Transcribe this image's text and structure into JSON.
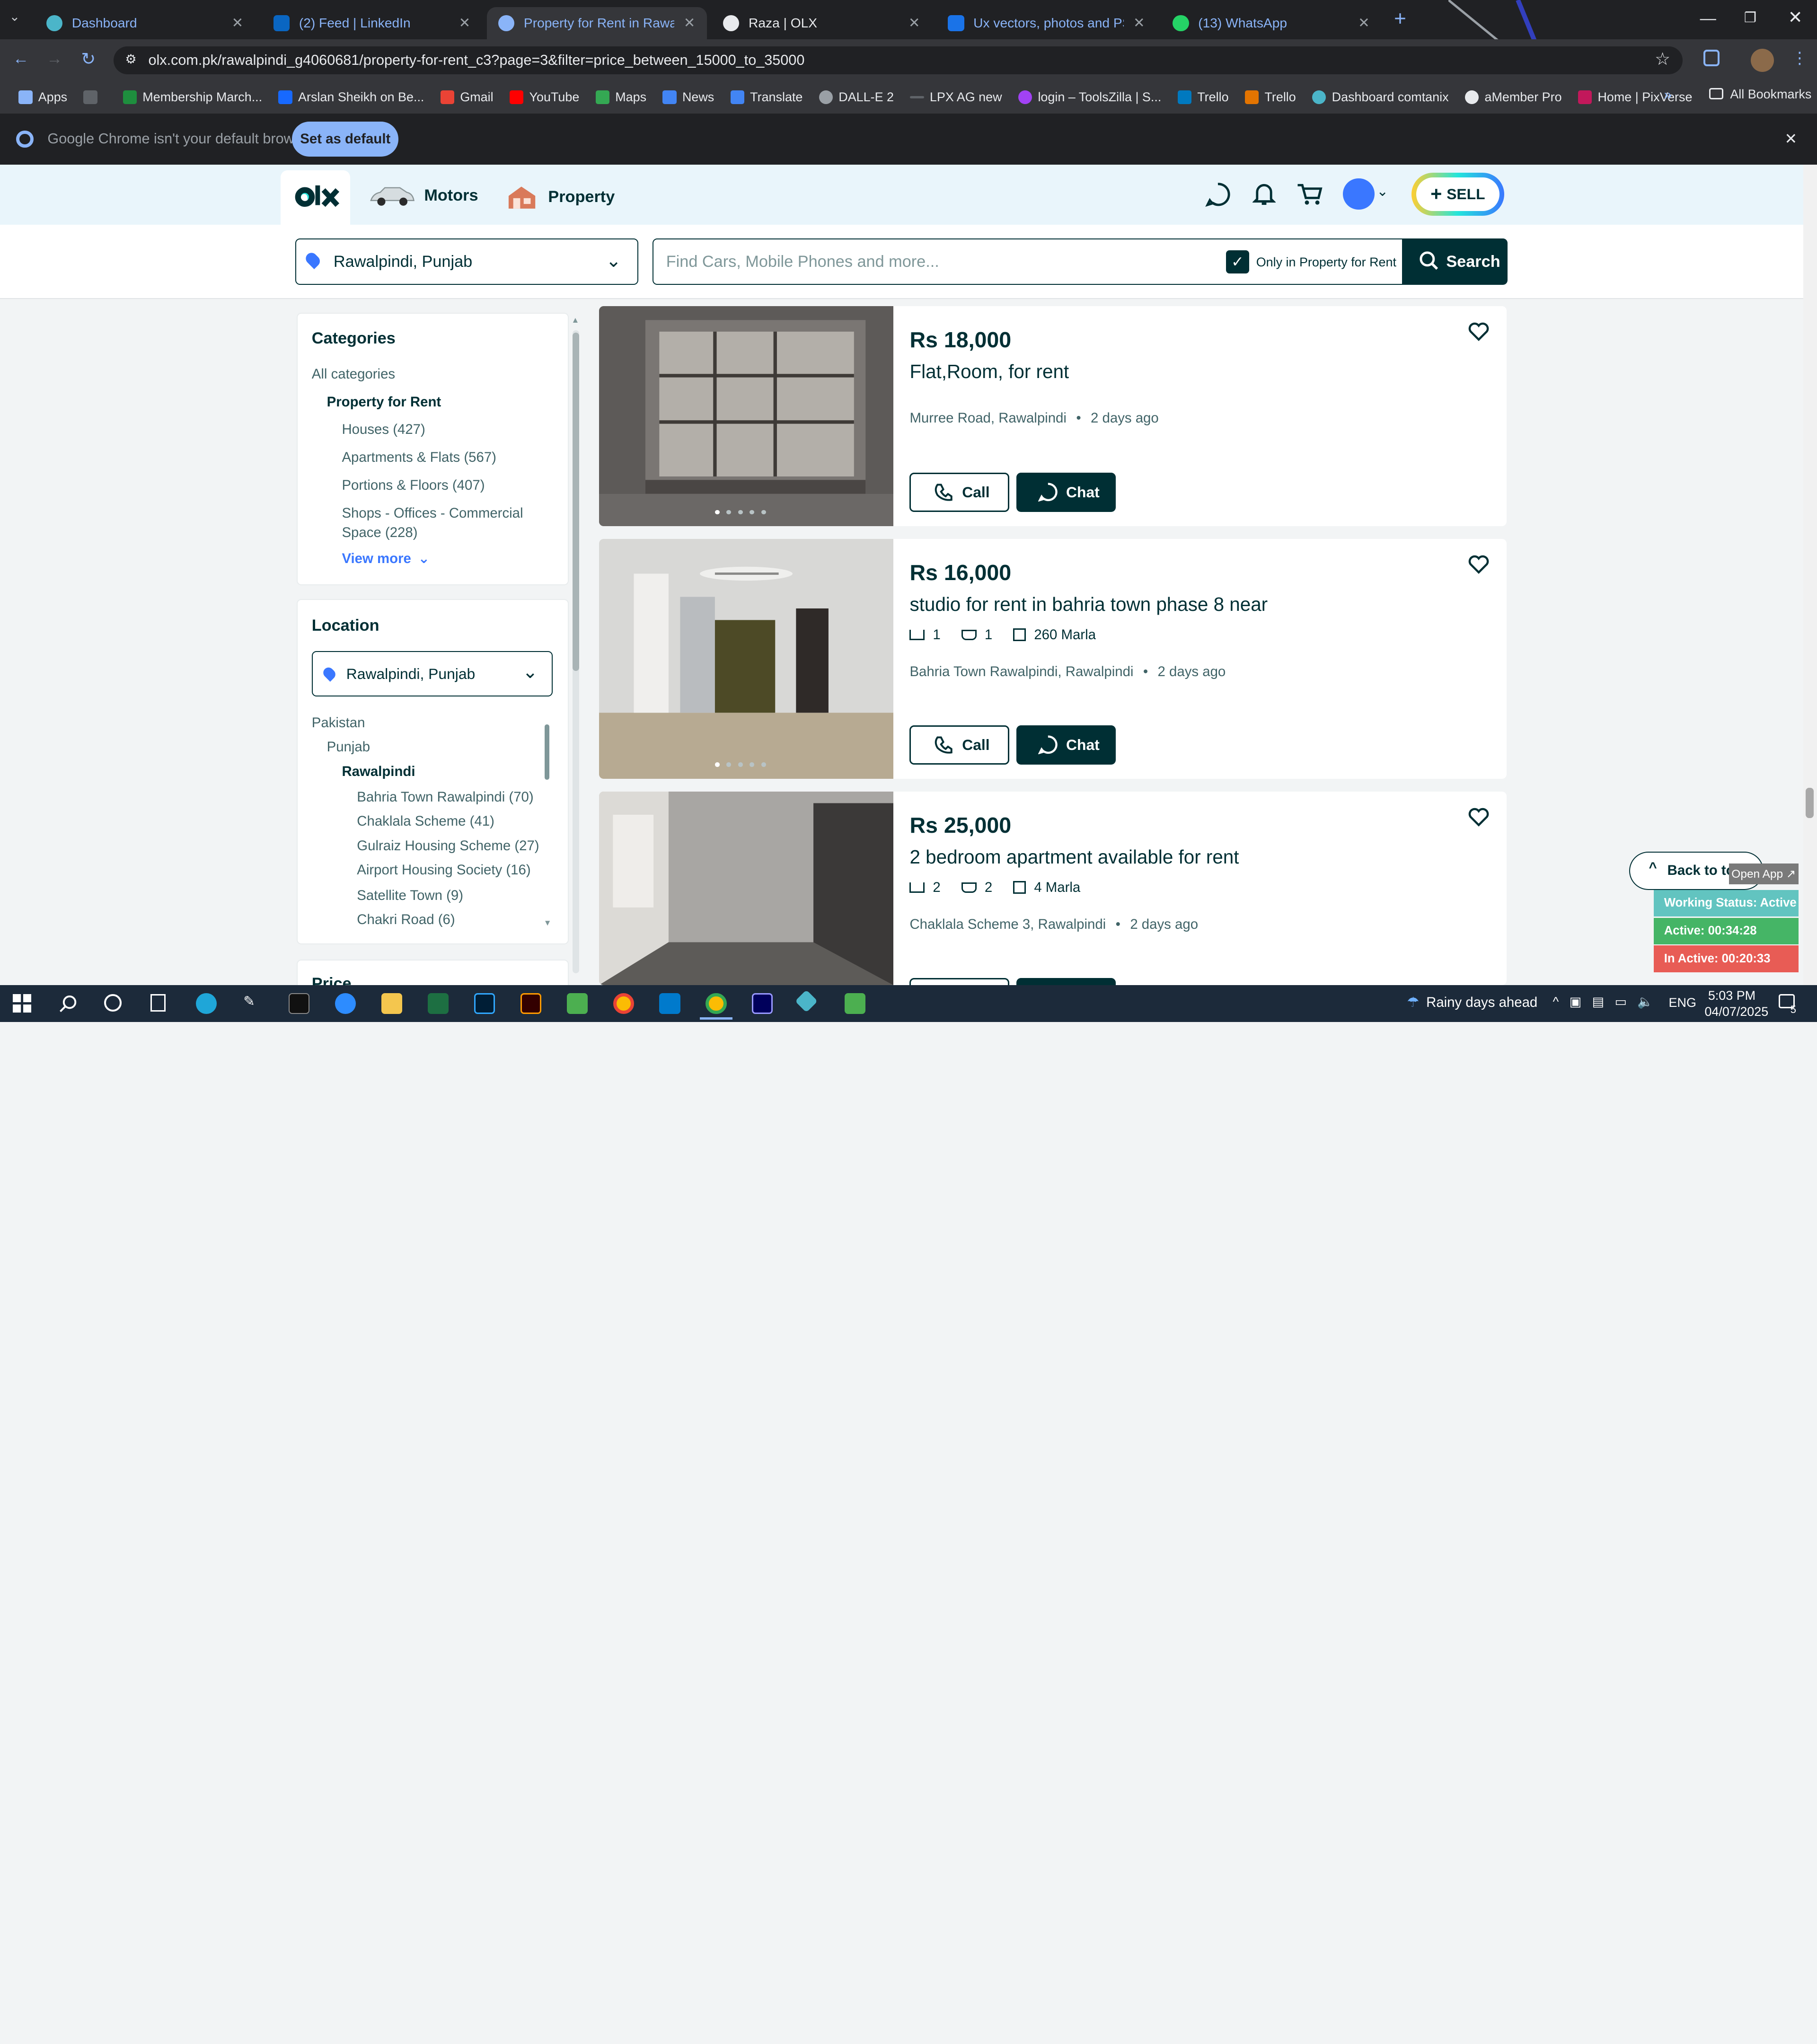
{
  "tabs": [
    {
      "title": "Dashboard",
      "icon_color": "#4bb5c9"
    },
    {
      "title": "(2) Feed | LinkedIn",
      "icon_color": "#0a66c2"
    },
    {
      "title": "Property for Rent in Rawalpindi",
      "icon_color": "#8ab4f8"
    },
    {
      "title": "Raza | OLX",
      "icon_color": "#8ab4f8"
    },
    {
      "title": "Ux vectors, photos and PSD file",
      "icon_color": "#1a73e8"
    },
    {
      "title": "(13) WhatsApp",
      "icon_color": "#25d366"
    }
  ],
  "address": "olx.com.pk/rawalpindi_g4060681/property-for-rent_c3?page=3&filter=price_between_15000_to_35000",
  "bookmarks": [
    "Apps",
    "Membership March...",
    "Arslan Sheikh on Be...",
    "Gmail",
    "YouTube",
    "Maps",
    "News",
    "Translate",
    "DALL-E 2",
    "LPX AG new",
    "login – ToolsZilla | S...",
    "Trello",
    "Trello",
    "Dashboard comtanix",
    "aMember Pro",
    "Home | PixVerse"
  ],
  "all_bookmarks": "All Bookmarks",
  "infobar": {
    "message": "Google Chrome isn't your default browser",
    "button": "Set as default"
  },
  "header": {
    "nav": [
      "Motors",
      "Property"
    ],
    "sell": "SELL"
  },
  "search": {
    "location": "Rawalpindi, Punjab",
    "placeholder": "Find Cars, Mobile Phones and more...",
    "only_label": "Only in Property for Rent",
    "button": "Search"
  },
  "categories": {
    "heading": "Categories",
    "all": "All categories",
    "current": "Property for Rent",
    "items": [
      "Houses (427)",
      "Apartments & Flats (567)",
      "Portions & Floors (407)",
      "Shops - Offices - Commercial",
      "Space (228)"
    ],
    "view_more": "View more"
  },
  "location": {
    "heading": "Location",
    "selected": "Rawalpindi, Punjab",
    "tree": [
      "Pakistan",
      "Punjab",
      "Rawalpindi"
    ],
    "areas": [
      "Bahria Town Rawalpindi (70)",
      "Chaklala Scheme (41)",
      "Gulraiz Housing Scheme (27)",
      "Airport Housing Society (16)",
      "Satellite Town (9)",
      "Chakri Road (6)"
    ]
  },
  "price_heading": "Price",
  "listings": [
    {
      "price": "Rs 18,000",
      "title": "Flat,Room, for rent",
      "location": "Murree Road, Rawalpindi",
      "age": "2 days ago"
    },
    {
      "price": "Rs 16,000",
      "title": "studio for rent in bahria town phase 8 near",
      "beds": "1",
      "baths": "1",
      "area": "260 Marla",
      "location": "Bahria Town Rawalpindi, Rawalpindi",
      "age": "2 days ago"
    },
    {
      "price": "Rs 25,000",
      "title": "2 bedroom apartment available for rent",
      "beds": "2",
      "baths": "2",
      "area": "4 Marla",
      "location": "Chaklala Scheme 3, Rawalpindi",
      "age": "2 days ago"
    }
  ],
  "buttons": {
    "call": "Call",
    "chat": "Chat"
  },
  "back_to_top": "Back to top",
  "widget": {
    "open_app": "Open App ↗",
    "status": "Working Status: Active",
    "active": "Active: 00:34:28",
    "inactive": "In Active: 00:20:33"
  },
  "taskbar": {
    "weather": "Rainy days ahead",
    "lang": "ENG",
    "time": "5:03 PM",
    "date": "04/07/2025",
    "notif": "5"
  }
}
